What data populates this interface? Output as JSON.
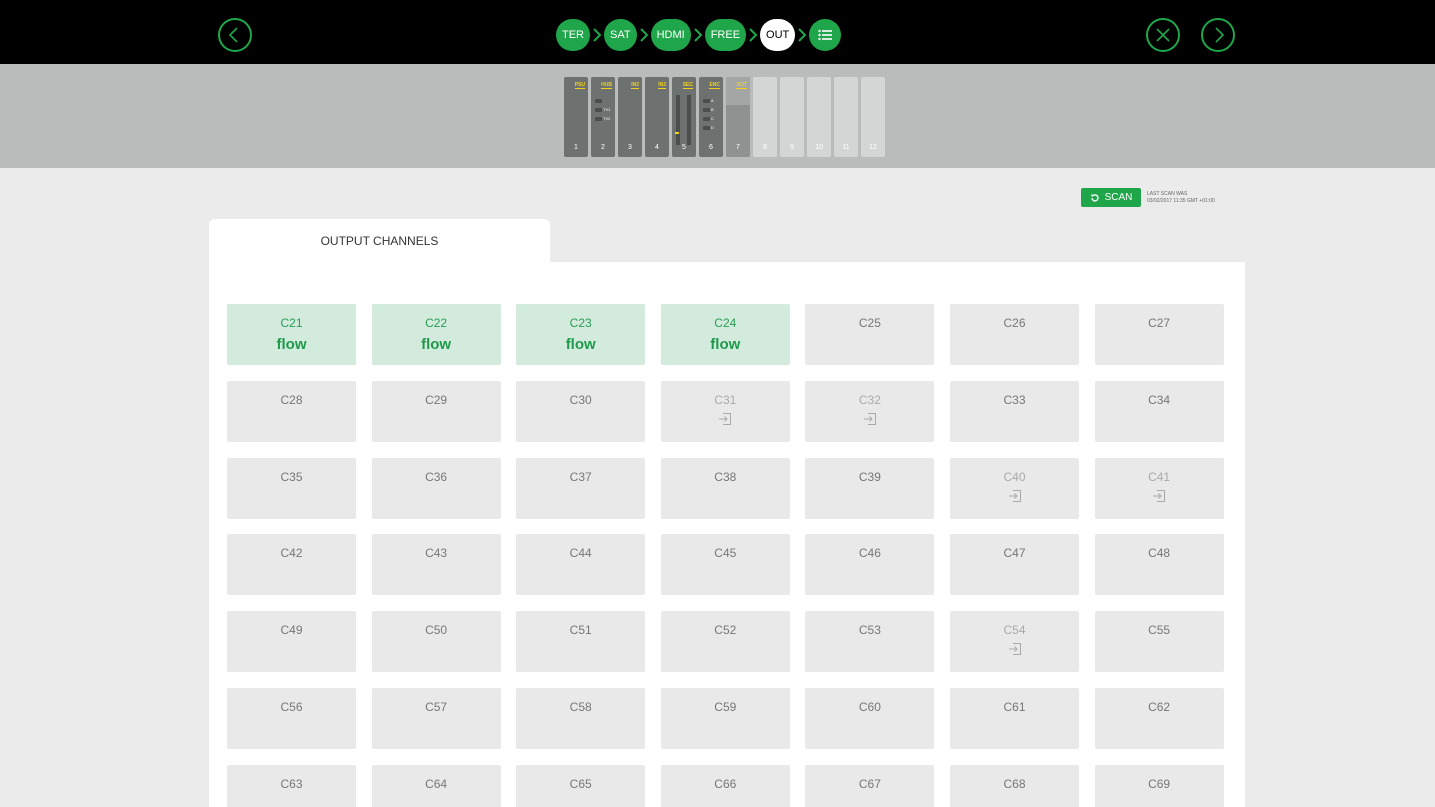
{
  "topbar": {
    "back_icon": "chevron-left-icon",
    "close_icon": "close-icon",
    "next_icon": "chevron-right-icon",
    "steps": [
      {
        "label": "TER",
        "state": "done"
      },
      {
        "label": "SAT",
        "state": "done"
      },
      {
        "label": "HDMI",
        "state": "done"
      },
      {
        "label": "FREE",
        "state": "done"
      },
      {
        "label": "OUT",
        "state": "current"
      }
    ],
    "list_icon": "list-icon",
    "accent": "#1fa64a"
  },
  "modules": {
    "slots": [
      {
        "num": "1",
        "name": "PSU",
        "state": "active"
      },
      {
        "num": "2",
        "name": "HUB",
        "state": "active",
        "ports": [
          "",
          "TV1",
          "TV2"
        ]
      },
      {
        "num": "3",
        "name": "IN2",
        "state": "active"
      },
      {
        "num": "4",
        "name": "IN2",
        "state": "active"
      },
      {
        "num": "5",
        "name": "SEC",
        "state": "active"
      },
      {
        "num": "6",
        "name": "ENC",
        "state": "active",
        "ports": [
          "A",
          "B",
          "C",
          "D"
        ]
      },
      {
        "num": "7",
        "name": "OUT",
        "state": "out"
      },
      {
        "num": "8",
        "name": "",
        "state": "empty"
      },
      {
        "num": "9",
        "name": "",
        "state": "empty"
      },
      {
        "num": "10",
        "name": "",
        "state": "empty"
      },
      {
        "num": "11",
        "name": "",
        "state": "empty"
      },
      {
        "num": "12",
        "name": "",
        "state": "empty"
      }
    ]
  },
  "scan": {
    "label": "SCAN",
    "icon": "refresh-icon",
    "info_line1": "LAST SCAN WAS",
    "info_line2": "03/02/2017 11:35 GMT +01:00"
  },
  "tab": {
    "label": "OUTPUT CHANNELS"
  },
  "channels": [
    {
      "name": "C21",
      "status": "flow"
    },
    {
      "name": "C22",
      "status": "flow"
    },
    {
      "name": "C23",
      "status": "flow"
    },
    {
      "name": "C24",
      "status": "flow"
    },
    {
      "name": "C25"
    },
    {
      "name": "C26"
    },
    {
      "name": "C27"
    },
    {
      "name": "C28"
    },
    {
      "name": "C29"
    },
    {
      "name": "C30"
    },
    {
      "name": "C31",
      "icon": "input-icon"
    },
    {
      "name": "C32",
      "icon": "input-icon"
    },
    {
      "name": "C33"
    },
    {
      "name": "C34"
    },
    {
      "name": "C35"
    },
    {
      "name": "C36"
    },
    {
      "name": "C37"
    },
    {
      "name": "C38"
    },
    {
      "name": "C39"
    },
    {
      "name": "C40",
      "icon": "input-icon"
    },
    {
      "name": "C41",
      "icon": "input-icon"
    },
    {
      "name": "C42"
    },
    {
      "name": "C43"
    },
    {
      "name": "C44"
    },
    {
      "name": "C45"
    },
    {
      "name": "C46"
    },
    {
      "name": "C47"
    },
    {
      "name": "C48"
    },
    {
      "name": "C49"
    },
    {
      "name": "C50"
    },
    {
      "name": "C51"
    },
    {
      "name": "C52"
    },
    {
      "name": "C53"
    },
    {
      "name": "C54",
      "icon": "input-icon"
    },
    {
      "name": "C55"
    },
    {
      "name": "C56"
    },
    {
      "name": "C57"
    },
    {
      "name": "C58"
    },
    {
      "name": "C59"
    },
    {
      "name": "C60"
    },
    {
      "name": "C61"
    },
    {
      "name": "C62"
    },
    {
      "name": "C63"
    },
    {
      "name": "C64"
    },
    {
      "name": "C65"
    },
    {
      "name": "C66"
    },
    {
      "name": "C67"
    },
    {
      "name": "C68"
    },
    {
      "name": "C69"
    }
  ]
}
